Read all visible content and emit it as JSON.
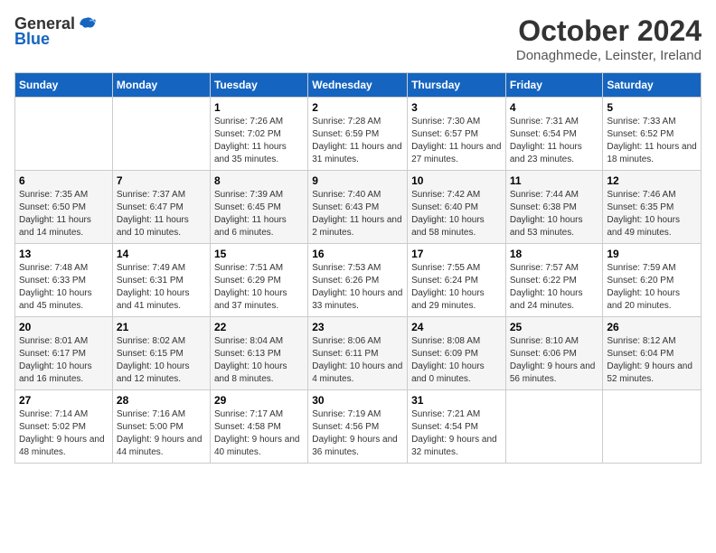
{
  "header": {
    "logo_general": "General",
    "logo_blue": "Blue",
    "month_title": "October 2024",
    "location": "Donaghmede, Leinster, Ireland"
  },
  "weekdays": [
    "Sunday",
    "Monday",
    "Tuesday",
    "Wednesday",
    "Thursday",
    "Friday",
    "Saturday"
  ],
  "weeks": [
    [
      {
        "day": "",
        "sunrise": "",
        "sunset": "",
        "daylight": ""
      },
      {
        "day": "",
        "sunrise": "",
        "sunset": "",
        "daylight": ""
      },
      {
        "day": "1",
        "sunrise": "Sunrise: 7:26 AM",
        "sunset": "Sunset: 7:02 PM",
        "daylight": "Daylight: 11 hours and 35 minutes."
      },
      {
        "day": "2",
        "sunrise": "Sunrise: 7:28 AM",
        "sunset": "Sunset: 6:59 PM",
        "daylight": "Daylight: 11 hours and 31 minutes."
      },
      {
        "day": "3",
        "sunrise": "Sunrise: 7:30 AM",
        "sunset": "Sunset: 6:57 PM",
        "daylight": "Daylight: 11 hours and 27 minutes."
      },
      {
        "day": "4",
        "sunrise": "Sunrise: 7:31 AM",
        "sunset": "Sunset: 6:54 PM",
        "daylight": "Daylight: 11 hours and 23 minutes."
      },
      {
        "day": "5",
        "sunrise": "Sunrise: 7:33 AM",
        "sunset": "Sunset: 6:52 PM",
        "daylight": "Daylight: 11 hours and 18 minutes."
      }
    ],
    [
      {
        "day": "6",
        "sunrise": "Sunrise: 7:35 AM",
        "sunset": "Sunset: 6:50 PM",
        "daylight": "Daylight: 11 hours and 14 minutes."
      },
      {
        "day": "7",
        "sunrise": "Sunrise: 7:37 AM",
        "sunset": "Sunset: 6:47 PM",
        "daylight": "Daylight: 11 hours and 10 minutes."
      },
      {
        "day": "8",
        "sunrise": "Sunrise: 7:39 AM",
        "sunset": "Sunset: 6:45 PM",
        "daylight": "Daylight: 11 hours and 6 minutes."
      },
      {
        "day": "9",
        "sunrise": "Sunrise: 7:40 AM",
        "sunset": "Sunset: 6:43 PM",
        "daylight": "Daylight: 11 hours and 2 minutes."
      },
      {
        "day": "10",
        "sunrise": "Sunrise: 7:42 AM",
        "sunset": "Sunset: 6:40 PM",
        "daylight": "Daylight: 10 hours and 58 minutes."
      },
      {
        "day": "11",
        "sunrise": "Sunrise: 7:44 AM",
        "sunset": "Sunset: 6:38 PM",
        "daylight": "Daylight: 10 hours and 53 minutes."
      },
      {
        "day": "12",
        "sunrise": "Sunrise: 7:46 AM",
        "sunset": "Sunset: 6:35 PM",
        "daylight": "Daylight: 10 hours and 49 minutes."
      }
    ],
    [
      {
        "day": "13",
        "sunrise": "Sunrise: 7:48 AM",
        "sunset": "Sunset: 6:33 PM",
        "daylight": "Daylight: 10 hours and 45 minutes."
      },
      {
        "day": "14",
        "sunrise": "Sunrise: 7:49 AM",
        "sunset": "Sunset: 6:31 PM",
        "daylight": "Daylight: 10 hours and 41 minutes."
      },
      {
        "day": "15",
        "sunrise": "Sunrise: 7:51 AM",
        "sunset": "Sunset: 6:29 PM",
        "daylight": "Daylight: 10 hours and 37 minutes."
      },
      {
        "day": "16",
        "sunrise": "Sunrise: 7:53 AM",
        "sunset": "Sunset: 6:26 PM",
        "daylight": "Daylight: 10 hours and 33 minutes."
      },
      {
        "day": "17",
        "sunrise": "Sunrise: 7:55 AM",
        "sunset": "Sunset: 6:24 PM",
        "daylight": "Daylight: 10 hours and 29 minutes."
      },
      {
        "day": "18",
        "sunrise": "Sunrise: 7:57 AM",
        "sunset": "Sunset: 6:22 PM",
        "daylight": "Daylight: 10 hours and 24 minutes."
      },
      {
        "day": "19",
        "sunrise": "Sunrise: 7:59 AM",
        "sunset": "Sunset: 6:20 PM",
        "daylight": "Daylight: 10 hours and 20 minutes."
      }
    ],
    [
      {
        "day": "20",
        "sunrise": "Sunrise: 8:01 AM",
        "sunset": "Sunset: 6:17 PM",
        "daylight": "Daylight: 10 hours and 16 minutes."
      },
      {
        "day": "21",
        "sunrise": "Sunrise: 8:02 AM",
        "sunset": "Sunset: 6:15 PM",
        "daylight": "Daylight: 10 hours and 12 minutes."
      },
      {
        "day": "22",
        "sunrise": "Sunrise: 8:04 AM",
        "sunset": "Sunset: 6:13 PM",
        "daylight": "Daylight: 10 hours and 8 minutes."
      },
      {
        "day": "23",
        "sunrise": "Sunrise: 8:06 AM",
        "sunset": "Sunset: 6:11 PM",
        "daylight": "Daylight: 10 hours and 4 minutes."
      },
      {
        "day": "24",
        "sunrise": "Sunrise: 8:08 AM",
        "sunset": "Sunset: 6:09 PM",
        "daylight": "Daylight: 10 hours and 0 minutes."
      },
      {
        "day": "25",
        "sunrise": "Sunrise: 8:10 AM",
        "sunset": "Sunset: 6:06 PM",
        "daylight": "Daylight: 9 hours and 56 minutes."
      },
      {
        "day": "26",
        "sunrise": "Sunrise: 8:12 AM",
        "sunset": "Sunset: 6:04 PM",
        "daylight": "Daylight: 9 hours and 52 minutes."
      }
    ],
    [
      {
        "day": "27",
        "sunrise": "Sunrise: 7:14 AM",
        "sunset": "Sunset: 5:02 PM",
        "daylight": "Daylight: 9 hours and 48 minutes."
      },
      {
        "day": "28",
        "sunrise": "Sunrise: 7:16 AM",
        "sunset": "Sunset: 5:00 PM",
        "daylight": "Daylight: 9 hours and 44 minutes."
      },
      {
        "day": "29",
        "sunrise": "Sunrise: 7:17 AM",
        "sunset": "Sunset: 4:58 PM",
        "daylight": "Daylight: 9 hours and 40 minutes."
      },
      {
        "day": "30",
        "sunrise": "Sunrise: 7:19 AM",
        "sunset": "Sunset: 4:56 PM",
        "daylight": "Daylight: 9 hours and 36 minutes."
      },
      {
        "day": "31",
        "sunrise": "Sunrise: 7:21 AM",
        "sunset": "Sunset: 4:54 PM",
        "daylight": "Daylight: 9 hours and 32 minutes."
      },
      {
        "day": "",
        "sunrise": "",
        "sunset": "",
        "daylight": ""
      },
      {
        "day": "",
        "sunrise": "",
        "sunset": "",
        "daylight": ""
      }
    ]
  ]
}
